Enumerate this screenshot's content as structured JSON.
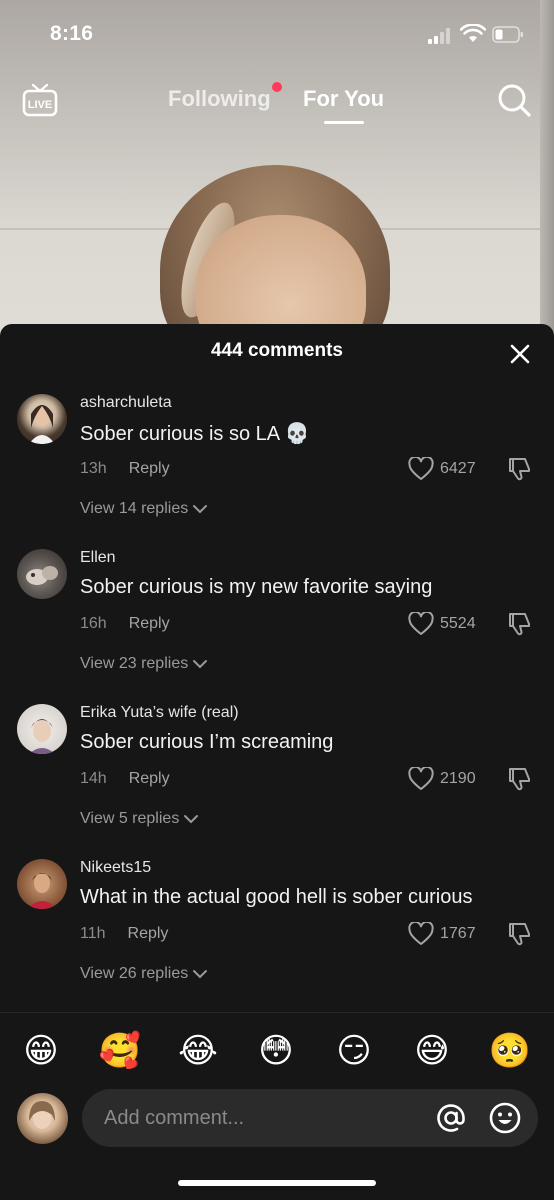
{
  "status_bar": {
    "time": "8:16"
  },
  "nav": {
    "live_label": "LIVE",
    "tab_following": "Following",
    "tab_for_you": "For You"
  },
  "comments_sheet": {
    "title": "444 comments",
    "comments": [
      {
        "username": "asharchuleta",
        "text": "Sober curious is so LA 💀",
        "age": "13h",
        "reply_label": "Reply",
        "likes": "6427",
        "view_replies": "View 14 replies"
      },
      {
        "username": "Ellen",
        "text": "Sober curious is my new favorite saying",
        "age": "16h",
        "reply_label": "Reply",
        "likes": "5524",
        "view_replies": "View 23 replies"
      },
      {
        "username": "Erika Yuta’s wife (real)",
        "text": "Sober curious I’m screaming",
        "age": "14h",
        "reply_label": "Reply",
        "likes": "2190",
        "view_replies": "View 5 replies"
      },
      {
        "username": "Nikeets15",
        "text": "What in the actual good hell is sober curious",
        "age": "11h",
        "reply_label": "Reply",
        "likes": "1767",
        "view_replies": "View 26 replies"
      }
    ]
  },
  "emoji_bar": [
    "😁",
    "🥰",
    "😂",
    "😳",
    "😏",
    "😅",
    "🥺"
  ],
  "comment_input": {
    "placeholder": "Add comment..."
  },
  "colors": {
    "sheet_bg": "#161616",
    "notification_dot": "#ff3b5c",
    "input_bg": "#2b2b2b"
  }
}
